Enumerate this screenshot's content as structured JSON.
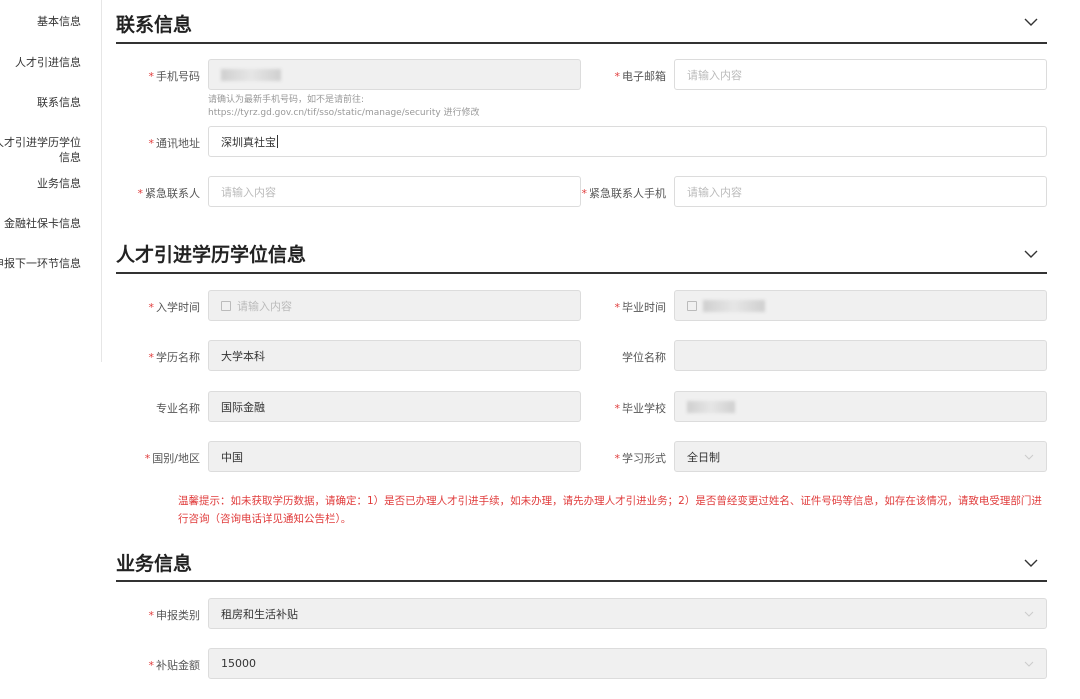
{
  "sidebar": {
    "items": [
      {
        "label": "基本信息"
      },
      {
        "label": "人才引进信息"
      },
      {
        "label": "联系信息"
      },
      {
        "label": "人才引进学历学位信息"
      },
      {
        "label": "业务信息"
      },
      {
        "label": "金融社保卡信息"
      },
      {
        "label": "申报下一环节信息"
      }
    ]
  },
  "contact": {
    "title": "联系信息",
    "phone_label": "手机号码",
    "phone_hint_1": "请确认为最新手机号码，如不是请前往:",
    "phone_hint_2": "https://tyrz.gd.gov.cn/tif/sso/static/manage/security 进行修改",
    "email_label": "电子邮箱",
    "email_placeholder": "请输入内容",
    "address_label": "通讯地址",
    "address_value": "深圳真社宝",
    "emergency_label": "紧急联系人",
    "emergency_placeholder": "请输入内容",
    "emergency_phone_label": "紧急联系人手机",
    "emergency_phone_placeholder": "请输入内容"
  },
  "education": {
    "title": "人才引进学历学位信息",
    "enroll_label": "入学时间",
    "enroll_placeholder": "请输入内容",
    "graduate_label": "毕业时间",
    "degree_name_label": "学历名称",
    "degree_name_value": "大学本科",
    "diploma_label": "学位名称",
    "major_label": "专业名称",
    "major_value": "国际金融",
    "school_label": "毕业学校",
    "country_label": "国别/地区",
    "country_value": "中国",
    "study_form_label": "学习形式",
    "study_form_value": "全日制",
    "warning": "温馨提示：如未获取学历数据，请确定：1）是否已办理人才引进手续，如未办理，请先办理人才引进业务；2）是否曾经变更过姓名、证件号码等信息，如存在该情况，请致电受理部门进行咨询（咨询电话详见通知公告栏）。"
  },
  "business": {
    "title": "业务信息",
    "type_label": "申报类别",
    "type_value": "租房和生活补贴",
    "amount_label": "补贴金额",
    "amount_value": "15000"
  },
  "required_mark": "*",
  "colors": {
    "required": "#e03c3c",
    "disabled_bg": "#f0f0f0",
    "rule": "#333333"
  },
  "icons": {
    "section_toggle": "chevron-down-icon",
    "date": "calendar-icon",
    "select": "select-caret-icon"
  }
}
